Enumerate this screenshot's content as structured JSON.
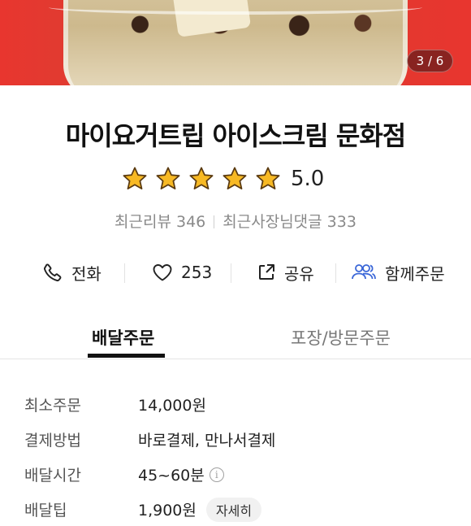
{
  "gallery": {
    "counter": "3 / 6"
  },
  "store": {
    "name": "마이요거트립 아이스크림 문화점",
    "rating": "5.0",
    "stars_filled": 5,
    "recent_reviews": "최근리뷰 346",
    "recent_owner_replies": "최근사장님댓글 333"
  },
  "actions": {
    "call_label": "전화",
    "like_count": "253",
    "share_label": "공유",
    "group_order_label": "함께주문"
  },
  "tabs": {
    "delivery": "배달주문",
    "pickup": "포장/방문주문",
    "active": "delivery"
  },
  "info": {
    "min_order_label": "최소주문",
    "min_order_value": "14,000원",
    "payment_label": "결제방법",
    "payment_value": "바로결제, 만나서결제",
    "delivery_time_label": "배달시간",
    "delivery_time_value": "45~60분",
    "delivery_tip_label": "배달팁",
    "delivery_tip_value": "1,900원",
    "detail_button": "자세히"
  },
  "colors": {
    "star_fill": "#f7b924",
    "star_stroke": "#5a3a10",
    "group_icon": "#3b67d8",
    "hero_bg": "#e23a30"
  }
}
